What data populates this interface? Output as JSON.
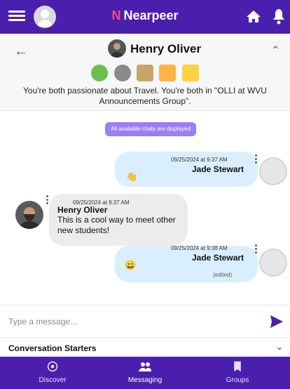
{
  "app": {
    "name": "Nearpeer"
  },
  "conversation": {
    "name": "Henry Oliver",
    "common_text": "You're both passionate about Travel. You're both in \"OLLI at WVU Announcements Group\".",
    "interest_icons": [
      "globe-icon",
      "target-icon",
      "people-icon",
      "sunset-icon",
      "flag-icon"
    ]
  },
  "notice": "All available chats are displayed",
  "messages": [
    {
      "timestamp": "09/25/2024 at 9:37 AM",
      "sender": "Jade Stewart",
      "text": "👋"
    },
    {
      "timestamp": "09/25/2024 at 9:37 AM",
      "sender": "Henry Oliver",
      "text": "This is a cool way to meet other new students!"
    },
    {
      "timestamp": "09/25/2024 at 9:38 AM",
      "sender": "Jade Stewart",
      "text": "😀",
      "edited": "(edited)"
    }
  ],
  "composer": {
    "placeholder": "Type a message..."
  },
  "starters": {
    "label": "Conversation Starters"
  },
  "nav": [
    {
      "label": "Discover",
      "icon": "compass-icon"
    },
    {
      "label": "Messaging",
      "icon": "people-icon"
    },
    {
      "label": "Groups",
      "icon": "bookmark-icon"
    }
  ],
  "colors": {
    "primary": "#4b1fae",
    "accent": "#ff4a7d",
    "outgoing_bubble": "#d9efff",
    "incoming_bubble": "#ececec",
    "notice": "#9b7ff1"
  }
}
